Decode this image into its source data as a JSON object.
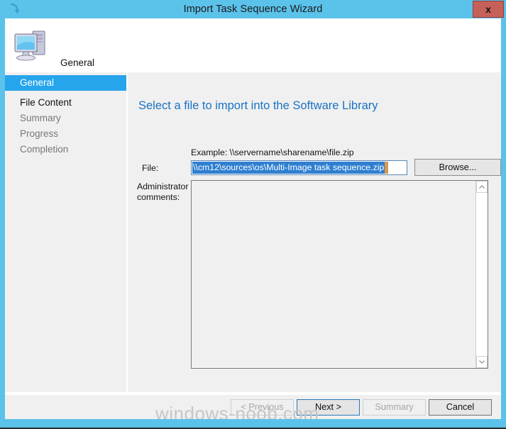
{
  "window": {
    "title": "Import Task Sequence Wizard",
    "title_icon": "import-arrow-icon",
    "close_label": "x",
    "accent_color": "#5bc2ea",
    "close_color": "#c8605a"
  },
  "header": {
    "icon": "computer-icon",
    "label": "General"
  },
  "sidebar": {
    "items": [
      {
        "label": "General",
        "state": "active"
      },
      {
        "label": "File Content",
        "state": "done"
      },
      {
        "label": "Summary",
        "state": "pending"
      },
      {
        "label": "Progress",
        "state": "pending"
      },
      {
        "label": "Completion",
        "state": "pending"
      }
    ]
  },
  "content": {
    "heading": "Select a file to import into the Software Library",
    "example_text": "Example: \\\\servername\\sharename\\file.zip",
    "file_label": "File:",
    "file_value": "\\\\cm12\\sources\\os\\Multi-Image task sequence.zip",
    "file_placeholder": "",
    "browse_label": "Browse...",
    "comments_label": "Administrator comments:",
    "comments_value": "",
    "comments_placeholder": ""
  },
  "footer": {
    "buttons": [
      {
        "label": "< Previous",
        "state": "disabled"
      },
      {
        "label": "Next >",
        "state": "default"
      },
      {
        "label": "Summary",
        "state": "disabled"
      },
      {
        "label": "Cancel",
        "state": "normal"
      }
    ]
  },
  "watermark": {
    "text": "windows-noob.com"
  }
}
